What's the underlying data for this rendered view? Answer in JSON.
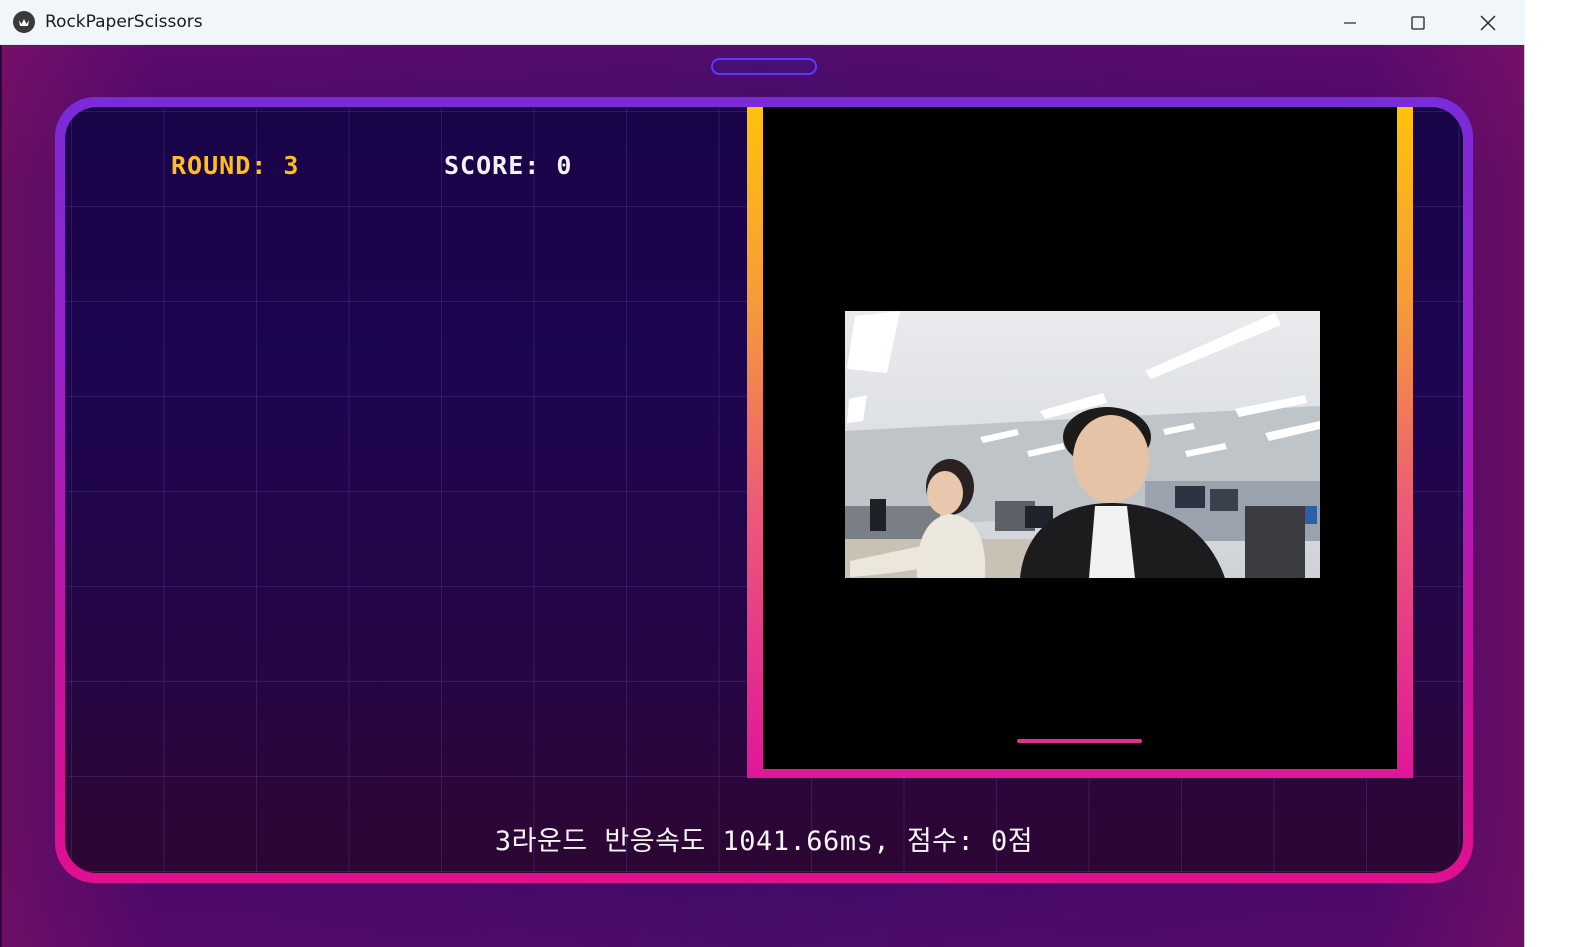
{
  "window": {
    "title": "RockPaperScissors",
    "controls": {
      "minimize": "minimize-icon",
      "maximize": "maximize-icon",
      "close": "close-icon"
    }
  },
  "hud": {
    "round_text": "ROUND: 3",
    "score_text": "SCORE: 0"
  },
  "camera": {
    "feed_description_icon": "webcam-feed",
    "timer_progress": 0.2
  },
  "result": {
    "message": "3라운드 반응속도 1041.66ms, 점수: 0점"
  },
  "colors": {
    "round_text": "#ffbf1a",
    "score_text": "#f2f2f2",
    "frame_top": "#7a2bd8",
    "frame_bottom": "#e0108f",
    "camera_border_top": "#ffc20a",
    "camera_border_bottom": "#e0169a",
    "timer_bar": "#ea2c8e"
  }
}
